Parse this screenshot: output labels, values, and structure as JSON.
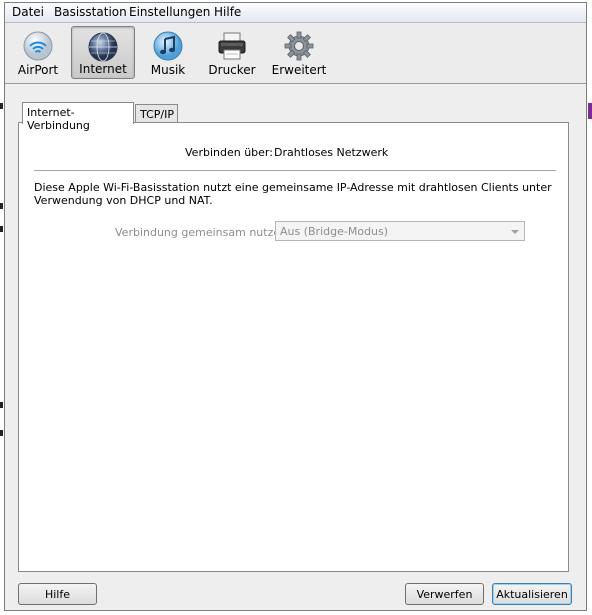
{
  "menubar": {
    "items": [
      "Datei",
      "Basisstation",
      "Einstellungen",
      "Hilfe"
    ]
  },
  "toolbar": {
    "items": [
      {
        "label": "AirPort",
        "icon": "airport-wifi-icon"
      },
      {
        "label": "Internet",
        "icon": "internet-globe-icon",
        "selected": true
      },
      {
        "label": "Musik",
        "icon": "music-note-icon"
      },
      {
        "label": "Drucker",
        "icon": "printer-icon"
      },
      {
        "label": "Erweitert",
        "icon": "advanced-gear-icon"
      }
    ]
  },
  "tabs": [
    "Internet-Verbindung",
    "TCP/IP"
  ],
  "internet": {
    "connect_label": "Verbinden über:",
    "connect_value": "Drahtloses Netzwerk",
    "description": "Diese Apple Wi-Fi-Basisstation nutzt eine gemeinsame IP-Adresse mit drahtlosen Clients unter Verwendung von DHCP und NAT.",
    "share_label": "Verbindung gemeinsam nutzen:",
    "share_value": "Aus (Bridge-Modus)"
  },
  "buttons": {
    "help": "Hilfe",
    "revert": "Verwerfen",
    "update": "Aktualisieren"
  },
  "colors": {
    "accent_button_border": "#3c7fb1",
    "disabled_text": "#8d8d8d"
  }
}
